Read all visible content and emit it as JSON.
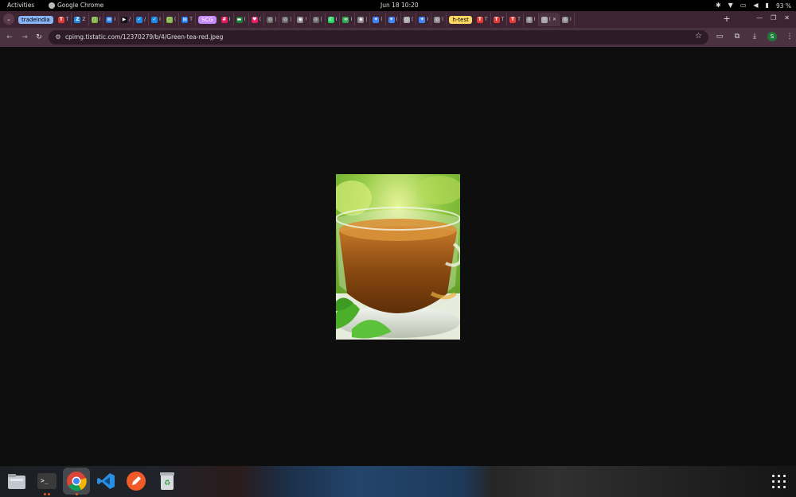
{
  "topbar": {
    "activities": "Activities",
    "app_name": "Google Chrome",
    "clock": "Jun 18  10:20",
    "battery": "93 %"
  },
  "tabs": [
    {
      "type": "group",
      "label": "tradeindia",
      "color": "#8ab4f8",
      "text_color": "#000"
    },
    {
      "type": "tab",
      "icon": "T",
      "color": "#e53935",
      "title": "T"
    },
    {
      "type": "tab",
      "icon": "Z",
      "color": "#1e88e5",
      "title": "Z"
    },
    {
      "type": "tab",
      "icon": "▢",
      "color": "#7cb342",
      "title": "I"
    },
    {
      "type": "tab",
      "icon": "▤",
      "color": "#1a73e8",
      "title": "I"
    },
    {
      "type": "tab",
      "icon": "▶",
      "color": "#111111",
      "title": "/"
    },
    {
      "type": "tab",
      "icon": "✓",
      "color": "#1e88e5",
      "title": "/"
    },
    {
      "type": "tab",
      "icon": "✓",
      "color": "#1e88e5",
      "title": "I"
    },
    {
      "type": "tab",
      "icon": "▢",
      "color": "#7cb342",
      "title": "("
    },
    {
      "type": "tab",
      "icon": "▤",
      "color": "#1a73e8",
      "title": "T"
    },
    {
      "type": "group",
      "label": "SCG",
      "color": "#c58af9",
      "text_color": "#fff"
    },
    {
      "type": "tab",
      "icon": "#",
      "color": "#e01e5a",
      "title": "I"
    },
    {
      "type": "tab",
      "icon": "▬",
      "color": "#188038",
      "title": "("
    },
    {
      "type": "tab",
      "icon": "♥",
      "color": "#e91e63",
      "title": "("
    },
    {
      "type": "tab",
      "icon": "◎",
      "color": "#666666",
      "title": "|"
    },
    {
      "type": "tab",
      "icon": "◎",
      "color": "#666666",
      "title": "|"
    },
    {
      "type": "tab",
      "icon": "◉",
      "color": "#888888",
      "title": "!"
    },
    {
      "type": "tab",
      "icon": "◎",
      "color": "#666666",
      "title": "|"
    },
    {
      "type": "tab",
      "icon": "✆",
      "color": "#25d366",
      "title": "I"
    },
    {
      "type": "tab",
      "icon": "∞",
      "color": "#34a853",
      "title": "I"
    },
    {
      "type": "tab",
      "icon": "◉",
      "color": "#888888",
      "title": "|"
    },
    {
      "type": "tab",
      "icon": "✦",
      "color": "#4285f4",
      "title": "("
    },
    {
      "type": "tab",
      "icon": "✦",
      "color": "#4285f4",
      "title": "("
    },
    {
      "type": "tab",
      "icon": "◇",
      "color": "#aaaaaa",
      "title": "("
    },
    {
      "type": "tab",
      "icon": "✦",
      "color": "#4285f4",
      "title": "I"
    },
    {
      "type": "tab",
      "icon": "◎",
      "color": "#888888",
      "title": "("
    },
    {
      "type": "group",
      "label": "h-test",
      "color": "#fdd663",
      "text_color": "#000"
    },
    {
      "type": "tab",
      "icon": "T",
      "color": "#e53935",
      "title": "T"
    },
    {
      "type": "tab",
      "icon": "T",
      "color": "#e53935",
      "title": "T"
    },
    {
      "type": "tab",
      "icon": "T",
      "color": "#e53935",
      "title": "T"
    },
    {
      "type": "tab",
      "icon": "◎",
      "color": "#888888",
      "title": "I"
    },
    {
      "type": "tab",
      "icon": "◦",
      "color": "#aaaaaa",
      "title": "(",
      "active": true
    },
    {
      "type": "tab",
      "icon": "◎",
      "color": "#888888",
      "title": "I"
    }
  ],
  "toolbar": {
    "url": "cpimg.tistatic.com/12370279/b/4/Green-tea-red.jpeg",
    "profile_initial": "S"
  },
  "image": {
    "alt": "Green-tea-red.jpeg"
  },
  "dock": {
    "apps": [
      "files",
      "terminal",
      "chrome",
      "vscode",
      "editor",
      "trash"
    ]
  }
}
